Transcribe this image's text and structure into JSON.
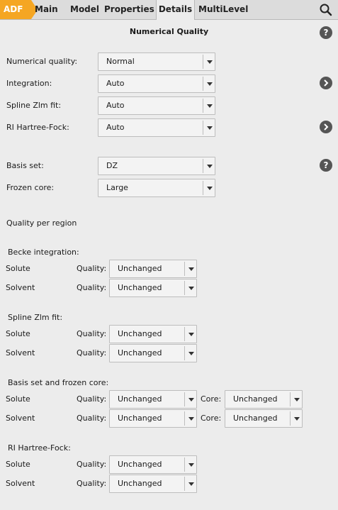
{
  "tabs": {
    "adf": "ADF",
    "main": "Main",
    "model": "Model",
    "properties": "Properties",
    "details": "Details",
    "multilevel": "MultiLevel"
  },
  "title": "Numerical Quality",
  "help_glyph": "?",
  "fields": {
    "numerical_quality": {
      "label": "Numerical quality:",
      "value": "Normal"
    },
    "integration": {
      "label": "Integration:",
      "value": "Auto"
    },
    "spline": {
      "label": "Spline Zlm fit:",
      "value": "Auto"
    },
    "rihf": {
      "label": "RI Hartree-Fock:",
      "value": "Auto"
    },
    "basis": {
      "label": "Basis set:",
      "value": "DZ"
    },
    "frozen": {
      "label": "Frozen core:",
      "value": "Large"
    }
  },
  "regions": {
    "heading": "Quality per region",
    "becke": {
      "heading": "Becke integration:",
      "solute": {
        "name": "Solute",
        "quality_label": "Quality:",
        "quality": "Unchanged"
      },
      "solvent": {
        "name": "Solvent",
        "quality_label": "Quality:",
        "quality": "Unchanged"
      }
    },
    "spline": {
      "heading": "Spline Zlm fit:",
      "solute": {
        "name": "Solute",
        "quality_label": "Quality:",
        "quality": "Unchanged"
      },
      "solvent": {
        "name": "Solvent",
        "quality_label": "Quality:",
        "quality": "Unchanged"
      }
    },
    "basis": {
      "heading": "Basis set and frozen core:",
      "solute": {
        "name": "Solute",
        "quality_label": "Quality:",
        "quality": "Unchanged",
        "core_label": "Core:",
        "core": "Unchanged"
      },
      "solvent": {
        "name": "Solvent",
        "quality_label": "Quality:",
        "quality": "Unchanged",
        "core_label": "Core:",
        "core": "Unchanged"
      }
    },
    "rihf": {
      "heading": "RI Hartree-Fock:",
      "solute": {
        "name": "Solute",
        "quality_label": "Quality:",
        "quality": "Unchanged"
      },
      "solvent": {
        "name": "Solvent",
        "quality_label": "Quality:",
        "quality": "Unchanged"
      }
    }
  },
  "icons": {
    "search": "search-icon",
    "help": "help-icon",
    "expand": "chevron-right-icon",
    "dropdown": "chevron-down-icon"
  },
  "colors": {
    "adf_tab": "#f5a623",
    "background": "#ececec",
    "icon_dark": "#555555"
  }
}
